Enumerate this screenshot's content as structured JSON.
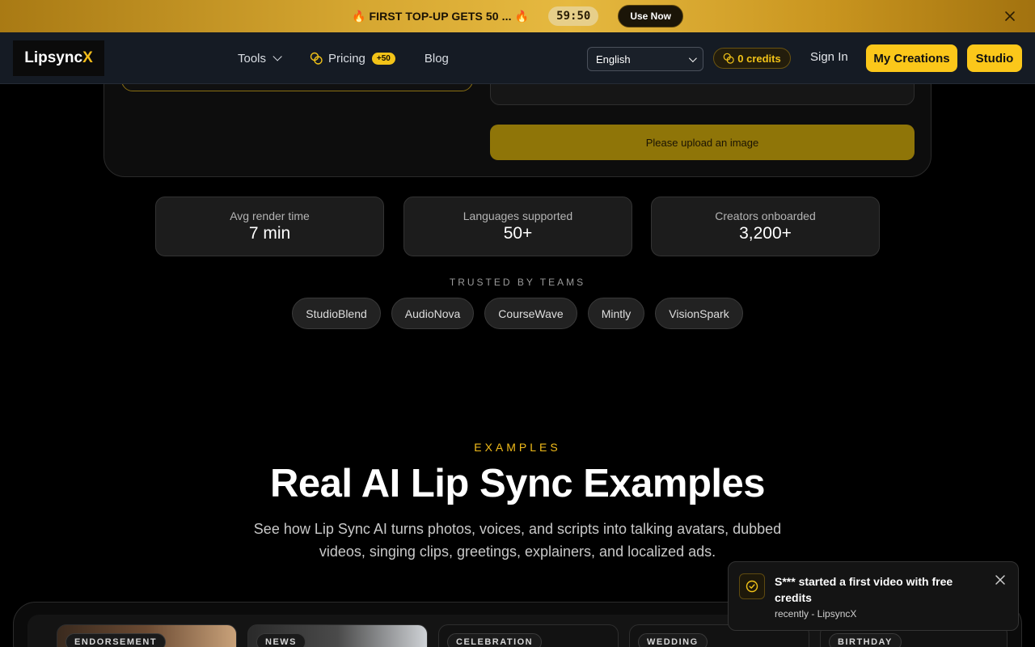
{
  "promo": {
    "text": "🔥 FIRST TOP-UP GETS 50 ... 🔥",
    "timer": "59:50",
    "button": "Use Now",
    "close_icon": "close-icon"
  },
  "nav": {
    "logo_main": "Lipsync",
    "logo_accent": "X",
    "tools": "Tools",
    "pricing": "Pricing",
    "pricing_badge": "+50",
    "blog": "Blog",
    "language": "English",
    "credits": "0 credits",
    "sign_in": "Sign In",
    "my_creations": "My Creations",
    "studio": "Studio"
  },
  "upload": {
    "button": "Please upload an image"
  },
  "stats": [
    {
      "label": "Avg render time",
      "value": "7 min"
    },
    {
      "label": "Languages supported",
      "value": "50+"
    },
    {
      "label": "Creators onboarded",
      "value": "3,200+"
    }
  ],
  "trusted": {
    "label": "TRUSTED BY TEAMS",
    "teams": [
      "StudioBlend",
      "AudioNova",
      "CourseWave",
      "Mintly",
      "VisionSpark"
    ]
  },
  "examples": {
    "eyebrow": "EXAMPLES",
    "title": "Real AI Lip Sync Examples",
    "subtitle": "See how Lip Sync AI turns photos, voices, and scripts into talking avatars, dubbed videos, singing clips, greetings, explainers, and localized ads.",
    "cards": [
      "ENDORSEMENT",
      "NEWS",
      "CELEBRATION",
      "WEDDING",
      "BIRTHDAY"
    ]
  },
  "toast": {
    "title": "S*** started a first video with free credits",
    "meta": "recently - LipsyncX"
  },
  "colors": {
    "accent": "#fbc71a",
    "promo_gold": "#d6a731",
    "upload_button": "#8f7508"
  }
}
